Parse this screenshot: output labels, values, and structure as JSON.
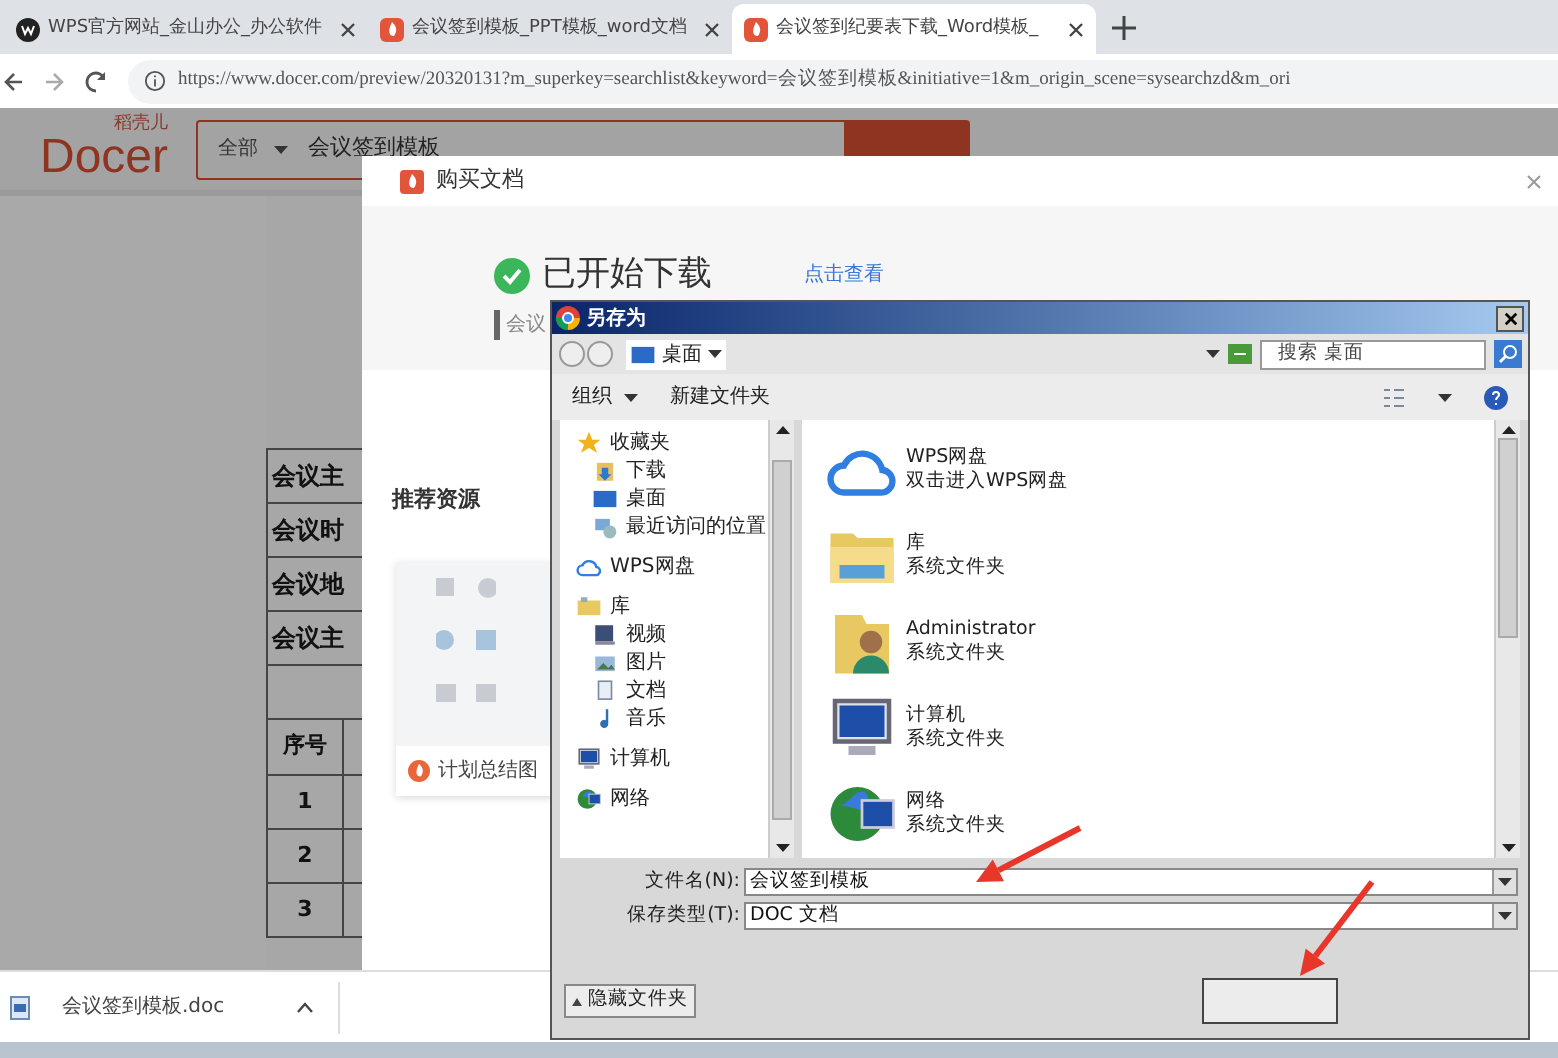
{
  "browser": {
    "tabs": [
      {
        "title": "WPS官方网站_金山办公_办公软件",
        "kind": "wps",
        "selected": false
      },
      {
        "title": "会议签到模板_PPT模板_word文档",
        "kind": "docer",
        "selected": false
      },
      {
        "title": "会议签到纪要表下载_Word模板_",
        "kind": "docer",
        "selected": true
      }
    ],
    "url": "https://www.docer.com/preview/20320131?m_superkey=searchlist&keyword=会议签到模板&initiative=1&m_origin_scene=sysearchzd&m_ori"
  },
  "page": {
    "logo_caption": "稻壳儿",
    "logo_text": "Docer",
    "search_scope": "全部",
    "search_value": "会议签到模板",
    "document_rows": [
      "会议主",
      "会议时",
      "会议地",
      "会议主"
    ],
    "table_header": "序号",
    "row_numbers": [
      "1",
      "2",
      "3"
    ]
  },
  "modal": {
    "title": "购买文档",
    "status": "已开始下载",
    "link": "点击查看",
    "file_label": "会议",
    "section_title": "推荐资源",
    "resource": "计划总结图"
  },
  "save_dialog": {
    "title": "另存为",
    "location": "桌面",
    "search_placeholder": "搜索 桌面",
    "toolbar": [
      "组织",
      "新建文件夹"
    ],
    "tree": [
      {
        "label": "收藏夹",
        "kind": "favorites",
        "children": [
          {
            "label": "下载",
            "kind": "download"
          },
          {
            "label": "桌面",
            "kind": "desktop"
          },
          {
            "label": "最近访问的位置",
            "kind": "recent"
          }
        ]
      },
      {
        "label": "WPS网盘",
        "kind": "cloud"
      },
      {
        "label": "库",
        "kind": "library",
        "children": [
          {
            "label": "视频",
            "kind": "video"
          },
          {
            "label": "图片",
            "kind": "picture"
          },
          {
            "label": "文档",
            "kind": "document"
          },
          {
            "label": "音乐",
            "kind": "music"
          }
        ]
      },
      {
        "label": "计算机",
        "kind": "computer"
      },
      {
        "label": "网络",
        "kind": "network"
      }
    ],
    "items": [
      {
        "name": "WPS网盘",
        "detail": "双击进入WPS网盘",
        "kind": "cloud"
      },
      {
        "name": "库",
        "detail": "系统文件夹",
        "kind": "library"
      },
      {
        "name": "Administrator",
        "detail": "系统文件夹",
        "kind": "user"
      },
      {
        "name": "计算机",
        "detail": "系统文件夹",
        "kind": "computer"
      },
      {
        "name": "网络",
        "detail": "系统文件夹",
        "kind": "network"
      }
    ],
    "file_name": {
      "label": "文件名(N):",
      "value": "会议签到模板"
    },
    "file_type": {
      "label": "保存类型(T):",
      "value": "DOC 文档"
    },
    "hide_folders": "隐藏文件夹"
  },
  "download_bar": {
    "file": "会议签到模板.doc"
  }
}
